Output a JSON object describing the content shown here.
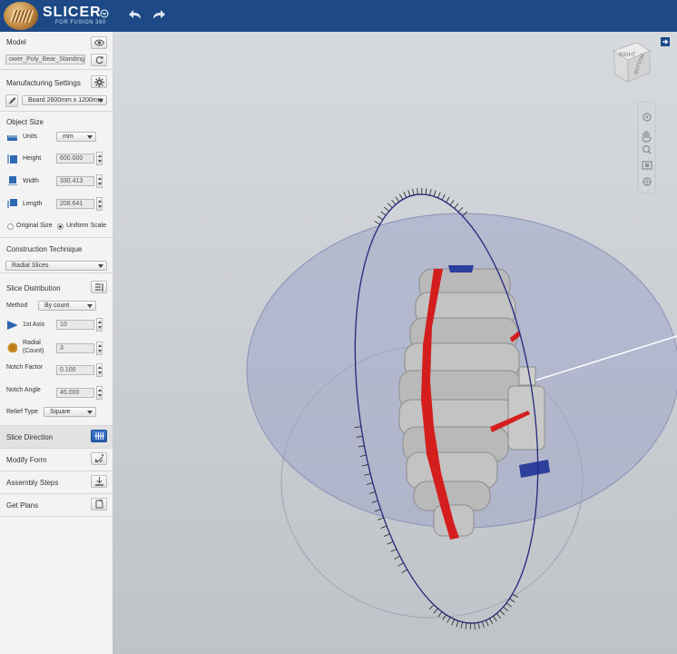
{
  "app": {
    "brand_title": "SLICER",
    "brand_subtitle": "FOR FUSION 360",
    "accent_color": "#1d4a86"
  },
  "toolbar": {
    "menu_icon": "circle-chevron-icon",
    "undo_icon": "undo-icon",
    "redo_icon": "redo-icon"
  },
  "model": {
    "title": "Model",
    "file_name": "ower_Poly_Bear_Standing.s",
    "visibility_icon": "eye-icon",
    "refresh_icon": "refresh-icon"
  },
  "manufacturing": {
    "title": "Manufacturing Settings",
    "selected_board": "Board 2600mm x 1200mm",
    "settings_icon": "gear-icon",
    "edit_icon": "pencil-icon"
  },
  "object_size": {
    "title": "Object Size",
    "units_label": "Units",
    "units_value": "mm",
    "height_label": "Height",
    "height_value": "600.000",
    "width_label": "Width",
    "width_value": "330.413",
    "length_label": "Length",
    "length_value": "208.641",
    "original_size_label": "Original Size",
    "uniform_scale_label": "Uniform Scale",
    "selected_scale": "Uniform Scale"
  },
  "construction": {
    "title": "Construction Technique",
    "selected": "Radial Slices"
  },
  "slice_distribution": {
    "title": "Slice Distribution",
    "method_label": "Method",
    "method_value": "By count",
    "first_axis_label": "1st Axis",
    "first_axis_value": "10",
    "radial_label_1": "Radial",
    "radial_label_2": "(Count)",
    "radial_value": "3",
    "notch_factor_label": "Notch Factor",
    "notch_factor_value": "0.100",
    "notch_angle_label": "Notch Angle",
    "notch_angle_value": "45.000",
    "relief_type_label": "Relief Type",
    "relief_type_value": "Square"
  },
  "nav": {
    "slice_direction": "Slice Direction",
    "modify_form": "Modify Form",
    "assembly_steps": "Assembly Steps",
    "get_plans": "Get Plans",
    "active": "Slice Direction"
  },
  "viewcube": {
    "face_top": "RIGHT",
    "face_front": "BOTTOM"
  },
  "colors": {
    "slice_red": "#d41e1e",
    "slice_gray": "#b9b9b9",
    "sphere_blue": "#9ea6c8",
    "ring_navy": "#23287a"
  }
}
